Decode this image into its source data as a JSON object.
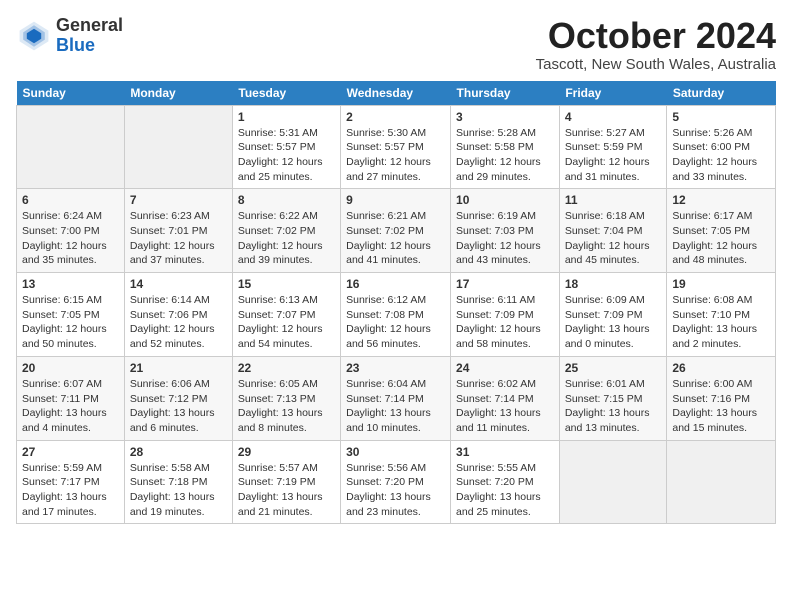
{
  "header": {
    "logo_general": "General",
    "logo_blue": "Blue",
    "month": "October 2024",
    "location": "Tascott, New South Wales, Australia"
  },
  "weekdays": [
    "Sunday",
    "Monday",
    "Tuesday",
    "Wednesday",
    "Thursday",
    "Friday",
    "Saturday"
  ],
  "weeks": [
    [
      {
        "day": "",
        "info": ""
      },
      {
        "day": "",
        "info": ""
      },
      {
        "day": "1",
        "info": "Sunrise: 5:31 AM\nSunset: 5:57 PM\nDaylight: 12 hours\nand 25 minutes."
      },
      {
        "day": "2",
        "info": "Sunrise: 5:30 AM\nSunset: 5:57 PM\nDaylight: 12 hours\nand 27 minutes."
      },
      {
        "day": "3",
        "info": "Sunrise: 5:28 AM\nSunset: 5:58 PM\nDaylight: 12 hours\nand 29 minutes."
      },
      {
        "day": "4",
        "info": "Sunrise: 5:27 AM\nSunset: 5:59 PM\nDaylight: 12 hours\nand 31 minutes."
      },
      {
        "day": "5",
        "info": "Sunrise: 5:26 AM\nSunset: 6:00 PM\nDaylight: 12 hours\nand 33 minutes."
      }
    ],
    [
      {
        "day": "6",
        "info": "Sunrise: 6:24 AM\nSunset: 7:00 PM\nDaylight: 12 hours\nand 35 minutes."
      },
      {
        "day": "7",
        "info": "Sunrise: 6:23 AM\nSunset: 7:01 PM\nDaylight: 12 hours\nand 37 minutes."
      },
      {
        "day": "8",
        "info": "Sunrise: 6:22 AM\nSunset: 7:02 PM\nDaylight: 12 hours\nand 39 minutes."
      },
      {
        "day": "9",
        "info": "Sunrise: 6:21 AM\nSunset: 7:02 PM\nDaylight: 12 hours\nand 41 minutes."
      },
      {
        "day": "10",
        "info": "Sunrise: 6:19 AM\nSunset: 7:03 PM\nDaylight: 12 hours\nand 43 minutes."
      },
      {
        "day": "11",
        "info": "Sunrise: 6:18 AM\nSunset: 7:04 PM\nDaylight: 12 hours\nand 45 minutes."
      },
      {
        "day": "12",
        "info": "Sunrise: 6:17 AM\nSunset: 7:05 PM\nDaylight: 12 hours\nand 48 minutes."
      }
    ],
    [
      {
        "day": "13",
        "info": "Sunrise: 6:15 AM\nSunset: 7:05 PM\nDaylight: 12 hours\nand 50 minutes."
      },
      {
        "day": "14",
        "info": "Sunrise: 6:14 AM\nSunset: 7:06 PM\nDaylight: 12 hours\nand 52 minutes."
      },
      {
        "day": "15",
        "info": "Sunrise: 6:13 AM\nSunset: 7:07 PM\nDaylight: 12 hours\nand 54 minutes."
      },
      {
        "day": "16",
        "info": "Sunrise: 6:12 AM\nSunset: 7:08 PM\nDaylight: 12 hours\nand 56 minutes."
      },
      {
        "day": "17",
        "info": "Sunrise: 6:11 AM\nSunset: 7:09 PM\nDaylight: 12 hours\nand 58 minutes."
      },
      {
        "day": "18",
        "info": "Sunrise: 6:09 AM\nSunset: 7:09 PM\nDaylight: 13 hours\nand 0 minutes."
      },
      {
        "day": "19",
        "info": "Sunrise: 6:08 AM\nSunset: 7:10 PM\nDaylight: 13 hours\nand 2 minutes."
      }
    ],
    [
      {
        "day": "20",
        "info": "Sunrise: 6:07 AM\nSunset: 7:11 PM\nDaylight: 13 hours\nand 4 minutes."
      },
      {
        "day": "21",
        "info": "Sunrise: 6:06 AM\nSunset: 7:12 PM\nDaylight: 13 hours\nand 6 minutes."
      },
      {
        "day": "22",
        "info": "Sunrise: 6:05 AM\nSunset: 7:13 PM\nDaylight: 13 hours\nand 8 minutes."
      },
      {
        "day": "23",
        "info": "Sunrise: 6:04 AM\nSunset: 7:14 PM\nDaylight: 13 hours\nand 10 minutes."
      },
      {
        "day": "24",
        "info": "Sunrise: 6:02 AM\nSunset: 7:14 PM\nDaylight: 13 hours\nand 11 minutes."
      },
      {
        "day": "25",
        "info": "Sunrise: 6:01 AM\nSunset: 7:15 PM\nDaylight: 13 hours\nand 13 minutes."
      },
      {
        "day": "26",
        "info": "Sunrise: 6:00 AM\nSunset: 7:16 PM\nDaylight: 13 hours\nand 15 minutes."
      }
    ],
    [
      {
        "day": "27",
        "info": "Sunrise: 5:59 AM\nSunset: 7:17 PM\nDaylight: 13 hours\nand 17 minutes."
      },
      {
        "day": "28",
        "info": "Sunrise: 5:58 AM\nSunset: 7:18 PM\nDaylight: 13 hours\nand 19 minutes."
      },
      {
        "day": "29",
        "info": "Sunrise: 5:57 AM\nSunset: 7:19 PM\nDaylight: 13 hours\nand 21 minutes."
      },
      {
        "day": "30",
        "info": "Sunrise: 5:56 AM\nSunset: 7:20 PM\nDaylight: 13 hours\nand 23 minutes."
      },
      {
        "day": "31",
        "info": "Sunrise: 5:55 AM\nSunset: 7:20 PM\nDaylight: 13 hours\nand 25 minutes."
      },
      {
        "day": "",
        "info": ""
      },
      {
        "day": "",
        "info": ""
      }
    ]
  ]
}
